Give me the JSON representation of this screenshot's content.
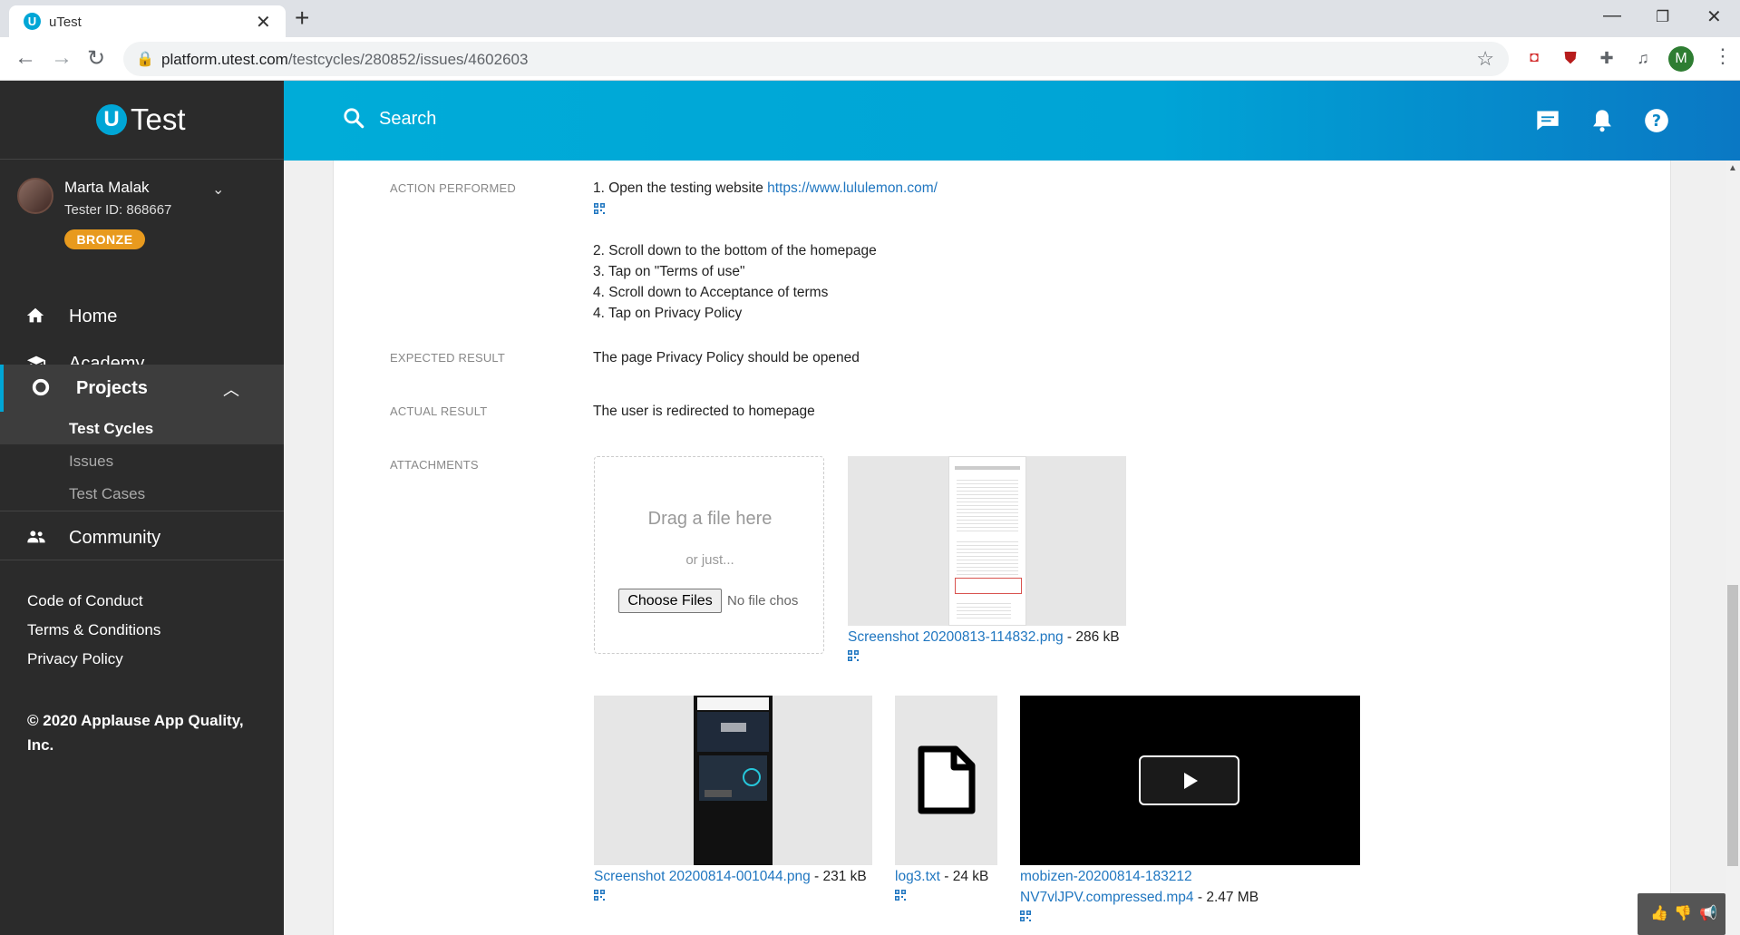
{
  "browser": {
    "tab_title": "uTest",
    "tab_favicon_letter": "U",
    "url_host": "platform.utest.com",
    "url_path": "/testcycles/280852/issues/4602603",
    "profile_letter": "M",
    "icons": [
      "back-icon",
      "forward-icon",
      "reload-icon",
      "lock-icon",
      "star-icon",
      "extensions-icon",
      "media-icon",
      "menu-icon"
    ]
  },
  "sidebar": {
    "logo_letter": "U",
    "logo_text": "Test",
    "user": {
      "name": "Marta Malak",
      "tester_id": "Tester ID: 868667",
      "badge": "BRONZE"
    },
    "nav": [
      {
        "label": "Home",
        "icon": "home-icon"
      },
      {
        "label": "Academy",
        "icon": "graduation-cap-icon"
      },
      {
        "label": "Projects",
        "icon": "ring-icon"
      },
      {
        "label": "Community",
        "icon": "people-icon"
      }
    ],
    "projects_sub": [
      "Test Cycles",
      "Issues",
      "Test Cases"
    ],
    "footer_links": [
      "Code of Conduct",
      "Terms & Conditions",
      "Privacy Policy"
    ],
    "copyright": "© 2020 Applause App Quality, Inc."
  },
  "header": {
    "search_label": "Search",
    "icons": [
      "chat-icon",
      "bell-icon",
      "help-icon"
    ]
  },
  "issue": {
    "action_label": "ACTION PERFORMED",
    "step1_text": "1. Open the testing website ",
    "step1_link": "https://www.lululemon.com/",
    "steps": [
      "2. Scroll down to the bottom of the homepage",
      "3. Tap on \"Terms of use\"",
      "4. Scroll down to Acceptance of terms",
      "4. Tap on Privacy Policy"
    ],
    "expected_label": "EXPECTED RESULT",
    "expected_value": "The page Privacy Policy should be opened",
    "actual_label": "ACTUAL RESULT",
    "actual_value": "The user is redirected to homepage",
    "attachments_label": "ATTACHMENTS"
  },
  "upload": {
    "title": "Drag a file here",
    "or_text": "or just...",
    "button_label": "Choose Files",
    "no_file": "No file chos"
  },
  "attachments": [
    {
      "name": "Screenshot 20200813-114832.png",
      "size": " - 286 kB",
      "kind": "image"
    },
    {
      "name": "Screenshot 20200814-001044.png",
      "size": " - 231 kB",
      "kind": "image"
    },
    {
      "name": "log3.txt",
      "size": " - 24 kB",
      "kind": "file"
    },
    {
      "name_line1": "mobizen-20200814-183212",
      "name_line2": "NV7vlJPV.compressed.mp4",
      "size": " - 2.47 MB",
      "kind": "video"
    }
  ],
  "colors": {
    "brand": "#00a6d6",
    "sidebar_bg": "#2b2b2b",
    "badge": "#e89a1e",
    "link": "#1f76c0"
  }
}
